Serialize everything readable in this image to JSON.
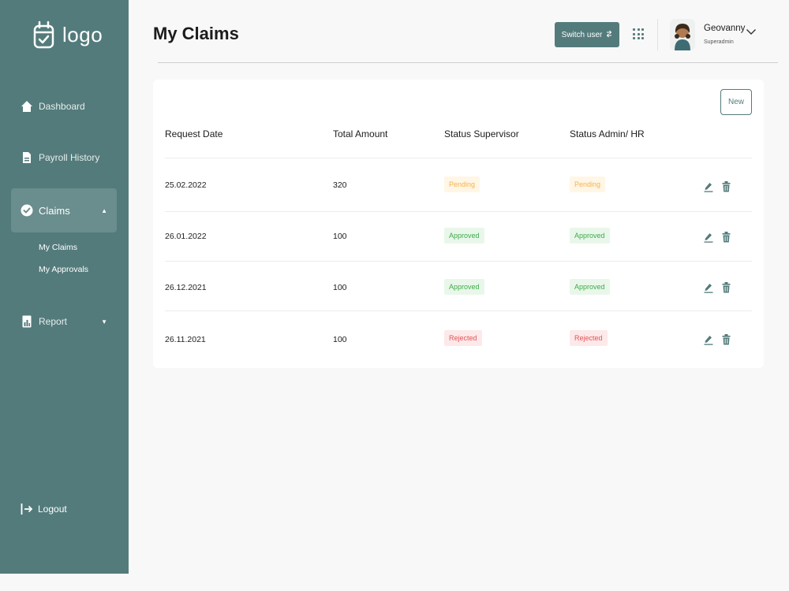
{
  "brand": {
    "logo_text": "logo",
    "logo_icon": "calendar-check-icon"
  },
  "sidebar": {
    "items": [
      {
        "label": "Dashboard",
        "icon": "home-icon"
      },
      {
        "label": "Payroll History",
        "icon": "document-icon"
      },
      {
        "label": "Claims",
        "icon": "check-circle-icon",
        "active": true,
        "caret": "▲"
      },
      {
        "label": "Report",
        "icon": "report-icon",
        "caret": "▼"
      }
    ],
    "claims_submenu": [
      "My Claims",
      "My Approvals"
    ],
    "logout_label": "Logout"
  },
  "header": {
    "title": "My Claims",
    "switch_user_label": "Switch user",
    "user_name": "Geovanny",
    "user_role": "Superadmin"
  },
  "claims": {
    "new_label": "New",
    "columns": [
      "Request Date",
      "Total Amount",
      "Status Supervisor",
      "Status Admin/ HR"
    ],
    "rows": [
      {
        "date": "25.02.2022",
        "amount": "320",
        "supervisor": "Pending",
        "admin": "Pending"
      },
      {
        "date": "26.01.2022",
        "amount": "100",
        "supervisor": "Approved",
        "admin": "Approved"
      },
      {
        "date": "26.12.2021",
        "amount": "100",
        "supervisor": "Approved",
        "admin": "Approved"
      },
      {
        "date": "26.11.2021",
        "amount": "100",
        "supervisor": "Rejected",
        "admin": "Rejected"
      }
    ]
  },
  "colors": {
    "sidebar": "#547b7b",
    "accent": "#547b7b",
    "pending": "#f5b34a",
    "approved": "#3faa4a",
    "rejected": "#e05555"
  }
}
